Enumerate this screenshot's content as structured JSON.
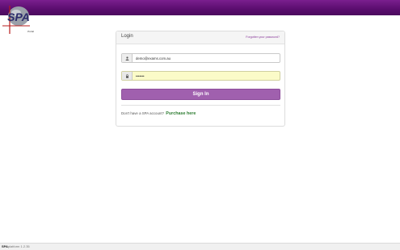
{
  "header": {
    "accent": "#5a0d6e"
  },
  "logo": {
    "text": "SPA",
    "subtext": "Portal"
  },
  "login": {
    "title": "Login",
    "forgot_link": "Forgotten your password?",
    "email": {
      "value": "demo@exams.com.au",
      "icon": "user-icon"
    },
    "password": {
      "value": "•••••••",
      "icon": "lock-icon"
    },
    "signin_label": "Sign In",
    "purchase_prompt": "Don't have a SPA account?",
    "purchase_link": "Purchase here"
  },
  "footer": {
    "brand": "SPA",
    "product": "platform",
    "version": "1.2.35"
  }
}
